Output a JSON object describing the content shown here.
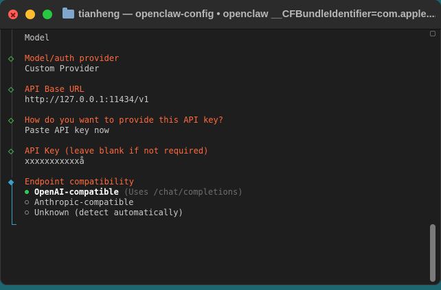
{
  "window": {
    "title": "tianheng — openclaw-config • openclaw __CFBundleIdentifier=com.apple...."
  },
  "terminal": {
    "model_label": "Model",
    "provider_heading": "Model/auth provider",
    "provider_value": "Custom Provider",
    "base_url_heading": "API Base URL",
    "base_url_value": "http://127.0.0.1:11434/v1",
    "api_key_method_heading": "How do you want to provide this API key?",
    "api_key_method_value": "Paste API key now",
    "api_key_heading": "API Key (leave blank if not required)",
    "api_key_value": "xxxxxxxxxxxå",
    "compat_heading": "Endpoint compatibility",
    "options": [
      {
        "label": "OpenAI-compatible",
        "hint": "(Uses /chat/completions)",
        "selected": true
      },
      {
        "label": "Anthropic-compatible",
        "hint": "",
        "selected": false
      },
      {
        "label": "Unknown (detect automatically)",
        "hint": "",
        "selected": false
      }
    ]
  },
  "colors": {
    "heading": "#ff6a3d",
    "done_marker": "#4caf50",
    "active_marker": "#3aa0c8",
    "selected_radio": "#34c759"
  },
  "icons": {
    "title": "folder-icon",
    "done": "diamond-outline-icon",
    "active": "diamond-filled-icon"
  }
}
